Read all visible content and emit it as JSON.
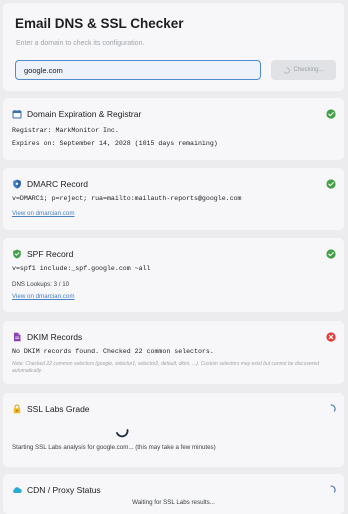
{
  "header": {
    "title": "Email DNS & SSL Checker",
    "subtitle": "Enter a domain to check its configuration.",
    "domain_value": "google.com",
    "check_button_label": "Checking..."
  },
  "colors": {
    "success": "#43a047",
    "error": "#e53935",
    "link": "#4a7fc1",
    "spinner": "#3b6fb0"
  },
  "cards": {
    "domain": {
      "title": "Domain Expiration & Registrar",
      "icon": "calendar-icon",
      "status": "success",
      "registrar": "Registrar: MarkMonitor Inc.",
      "expires": "Expires on: September 14, 2028 (1015 days remaining)"
    },
    "dmarc": {
      "title": "DMARC Record",
      "icon": "shield-icon",
      "status": "success",
      "record": "v=DMARC1; p=reject; rua=mailto:mailauth-reports@google.com",
      "link": "View on dmarcian.com"
    },
    "spf": {
      "title": "SPF Record",
      "icon": "shield-check-icon",
      "status": "success",
      "record": "v=spf1 include:_spf.google.com ~all",
      "lookups": "DNS Lookups: 3 / 10",
      "link": "View on dmarcian.com"
    },
    "dkim": {
      "title": "DKIM Records",
      "icon": "document-icon",
      "status": "error",
      "message": "No DKIM records found. Checked 22 common selectors.",
      "note": "Note: Checked 22 common selectors (google, selector1, selector2, default, dkim, ...). Custom selectors may exist but cannot be discovered automatically."
    },
    "ssl": {
      "title": "SSL Labs Grade",
      "icon": "lock-icon",
      "status": "loading",
      "message": "Starting SSL Labs analysis for google.com... (this may take a few minutes)"
    },
    "cdn": {
      "title": "CDN / Proxy Status",
      "icon": "cloud-icon",
      "status": "loading",
      "message": "Waiting for SSL Labs results..."
    }
  }
}
